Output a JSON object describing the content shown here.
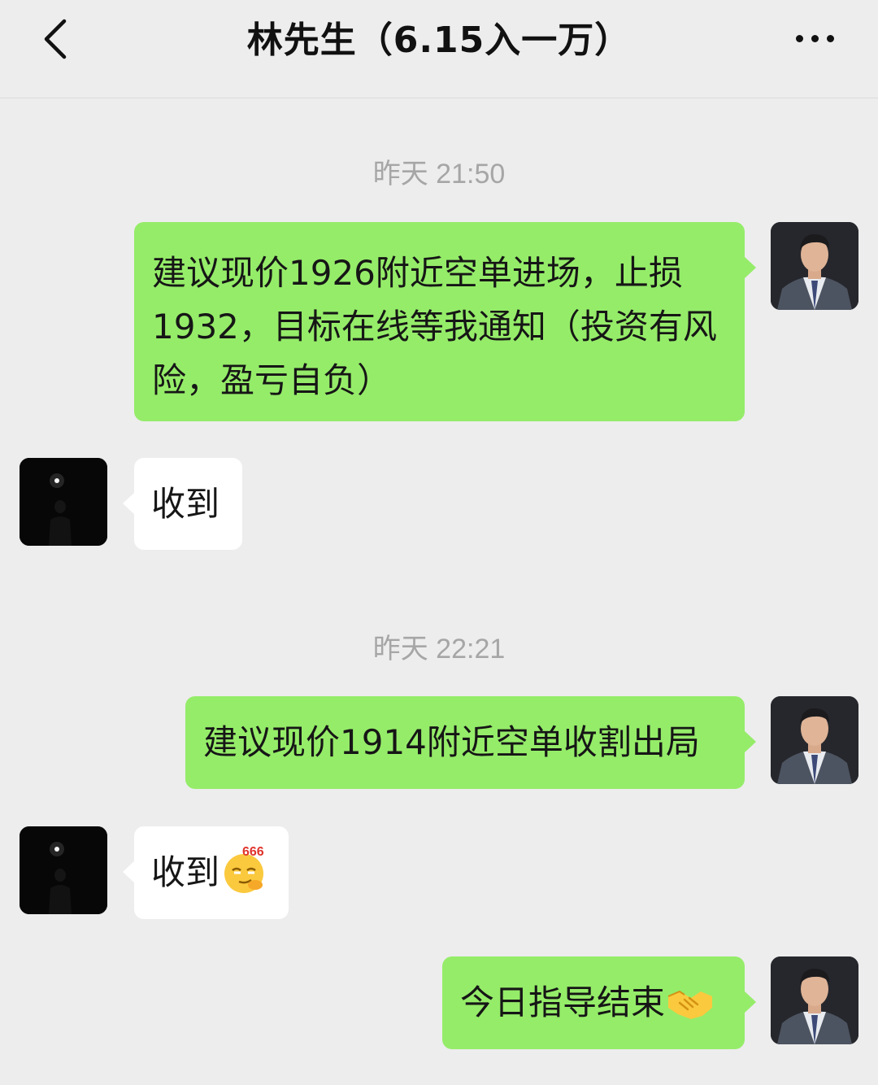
{
  "header": {
    "title": "林先生（6.15入一万）",
    "back_icon": "chevron-left-icon",
    "more_icon": "more-dots-icon"
  },
  "colors": {
    "background": "#ededed",
    "my_bubble": "#95ec69",
    "peer_bubble": "#ffffff",
    "timestamp": "#a6a6a6"
  },
  "messages": [
    {
      "type": "timestamp",
      "text": "昨天 21:50"
    },
    {
      "type": "me",
      "text": "建议现价1926附近空单进场，止损1932，目标在线等我通知（投资有风险，盈亏自负）"
    },
    {
      "type": "peer",
      "text": "收到"
    },
    {
      "type": "timestamp",
      "text": "昨天 22:21"
    },
    {
      "type": "me",
      "text": "建议现价1914附近空单收割出局"
    },
    {
      "type": "peer",
      "text": "收到",
      "emoji": "666-smirk-emoji",
      "emoji_text": "666"
    },
    {
      "type": "me",
      "text": "今日指导结束",
      "emoji": "handshake-emoji"
    }
  ]
}
